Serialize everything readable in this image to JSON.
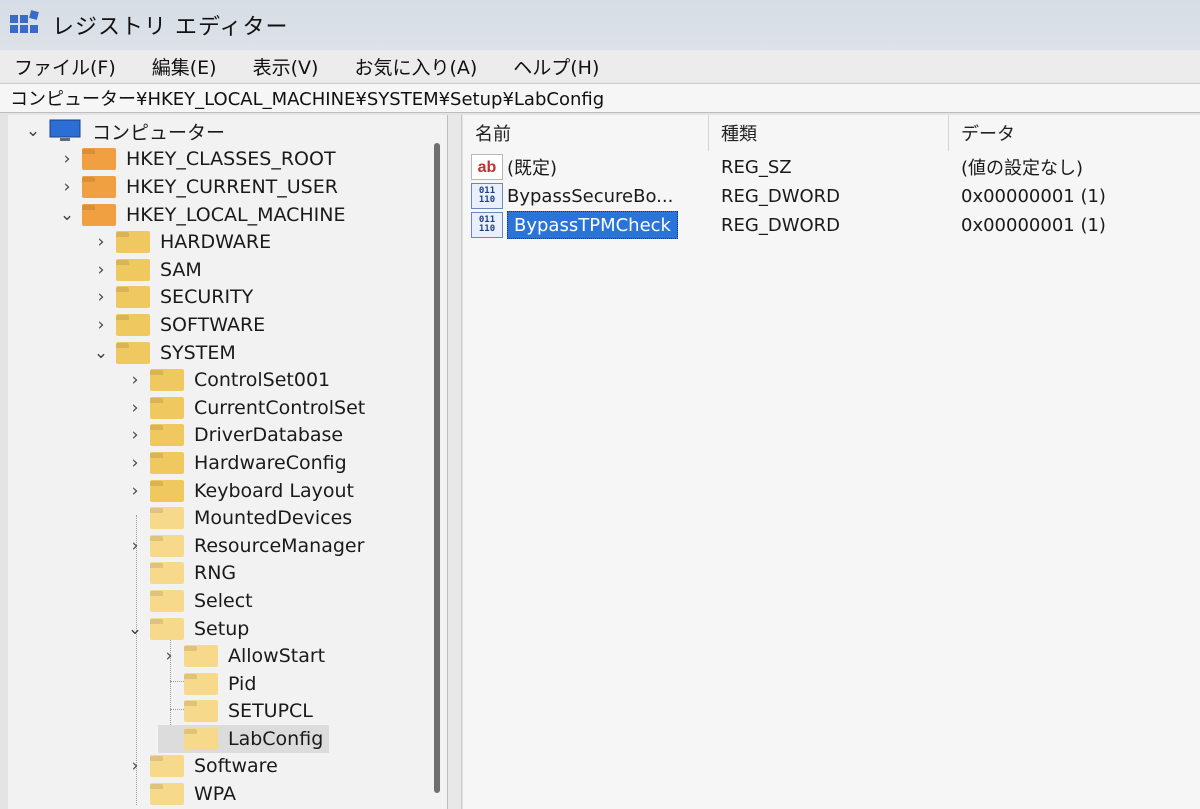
{
  "window": {
    "title": "レジストリ エディター"
  },
  "menu": [
    "ファイル(F)",
    "編集(E)",
    "表示(V)",
    "お気に入り(A)",
    "ヘルプ(H)"
  ],
  "address": "コンピューター¥HKEY_LOCAL_MACHINE¥SYSTEM¥Setup¥LabConfig",
  "tree": {
    "root": "コンピューター",
    "hives": [
      "HKEY_CLASSES_ROOT",
      "HKEY_CURRENT_USER",
      "HKEY_LOCAL_MACHINE"
    ],
    "hklm_children": [
      "HARDWARE",
      "SAM",
      "SECURITY",
      "SOFTWARE",
      "SYSTEM"
    ],
    "system_children": [
      "ControlSet001",
      "CurrentControlSet",
      "DriverDatabase",
      "HardwareConfig",
      "Keyboard Layout",
      "MountedDevices",
      "ResourceManager",
      "RNG",
      "Select",
      "Setup",
      "Software",
      "WPA"
    ],
    "setup_children": [
      "AllowStart",
      "Pid",
      "SETUPCL",
      "LabConfig"
    ]
  },
  "list": {
    "columns": [
      "名前",
      "種類",
      "データ"
    ],
    "rows": [
      {
        "icon": "string-value-icon",
        "name": "(既定)",
        "type": "REG_SZ",
        "data": "(値の設定なし)"
      },
      {
        "icon": "dword-value-icon",
        "name": "BypassSecureBo...",
        "type": "REG_DWORD",
        "data": "0x00000001 (1)"
      },
      {
        "icon": "dword-value-icon",
        "name": "BypassTPMCheck",
        "type": "REG_DWORD",
        "data": "0x00000001 (1)"
      }
    ]
  },
  "icon_glyphs": {
    "string": "ab",
    "binary_top": "011",
    "binary_bottom": "110"
  },
  "colors": {
    "selection": "#2a73d9",
    "folder_orange": "#f0a040",
    "folder_yellow": "#f0c860"
  }
}
